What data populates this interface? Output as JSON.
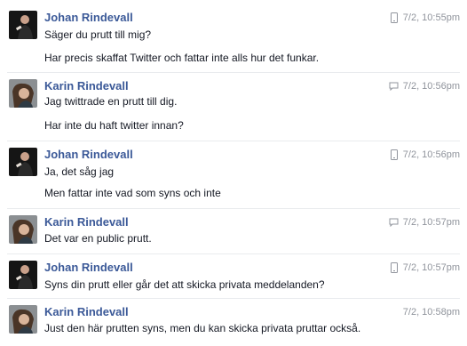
{
  "messages": [
    {
      "sender": "Johan Rindevall",
      "avatar": "johan",
      "icon": "mobile-icon",
      "time": "7/2, 10:55pm",
      "lines": [
        "Säger du prutt till mig?",
        "Har precis skaffat Twitter och fattar inte alls hur det funkar."
      ]
    },
    {
      "sender": "Karin Rindevall",
      "avatar": "karin",
      "icon": "chat-icon",
      "time": "7/2, 10:56pm",
      "lines": [
        "Jag twittrade en prutt till dig.",
        "Har inte du haft twitter innan?"
      ]
    },
    {
      "sender": "Johan Rindevall",
      "avatar": "johan",
      "icon": "mobile-icon",
      "time": "7/2, 10:56pm",
      "lines": [
        "Ja, det såg jag",
        "Men fattar inte vad som syns och inte"
      ]
    },
    {
      "sender": "Karin Rindevall",
      "avatar": "karin",
      "icon": "chat-icon",
      "time": "7/2, 10:57pm",
      "lines": [
        "Det var en public prutt."
      ]
    },
    {
      "sender": "Johan Rindevall",
      "avatar": "johan",
      "icon": "mobile-icon",
      "time": "7/2, 10:57pm",
      "lines": [
        "Syns din prutt eller går det att skicka privata meddelanden?"
      ]
    },
    {
      "sender": "Karin Rindevall",
      "avatar": "karin",
      "icon": "none",
      "time": "7/2, 10:58pm",
      "lines": [
        "Just den här prutten syns, men du kan skicka privata pruttar också."
      ]
    }
  ]
}
